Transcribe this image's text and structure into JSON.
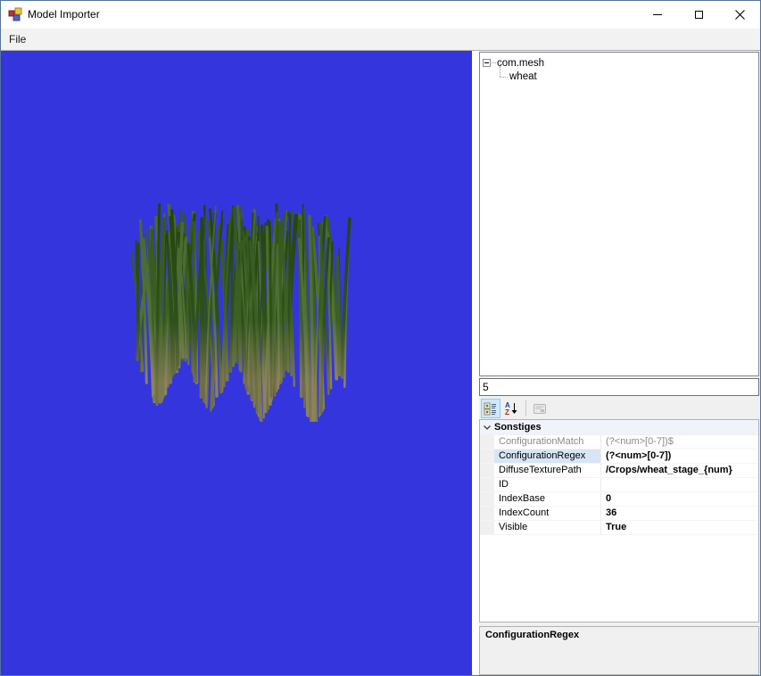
{
  "window": {
    "title": "Model Importer"
  },
  "titlebar": {
    "buttons": [
      "minimize",
      "maximize",
      "close"
    ]
  },
  "menu": {
    "items": [
      {
        "label": "File"
      }
    ]
  },
  "viewport": {
    "background_color": "#3535de",
    "model_name": "wheat"
  },
  "tree": {
    "root": {
      "label": "com.mesh",
      "expanded": true
    },
    "child": {
      "label": "wheat"
    }
  },
  "filterBox": {
    "value": "5"
  },
  "propertyGrid": {
    "toolbar": {
      "buttons": [
        "categorized",
        "alphabetical",
        "property-pages"
      ],
      "selected": "categorized"
    },
    "categoryLabel": "Sonstiges",
    "selectedProperty": "ConfigurationRegex",
    "rows": [
      {
        "name": "ConfigurationMatch",
        "value": "(?<num>[0-7])$",
        "state": "readonly",
        "modified": false
      },
      {
        "name": "ConfigurationRegex",
        "value": "(?<num>[0-7])",
        "state": "selected",
        "modified": true
      },
      {
        "name": "DiffuseTexturePath",
        "value": "/Crops/wheat_stage_{num}",
        "state": "normal",
        "modified": true
      },
      {
        "name": "ID",
        "value": "",
        "state": "normal",
        "modified": false
      },
      {
        "name": "IndexBase",
        "value": "0",
        "state": "normal",
        "modified": true
      },
      {
        "name": "IndexCount",
        "value": "36",
        "state": "normal",
        "modified": true
      },
      {
        "name": "Visible",
        "value": "True",
        "state": "normal",
        "modified": true
      }
    ],
    "help": {
      "title": "ConfigurationRegex"
    }
  },
  "colors": {
    "window_border": "#54749c",
    "viewport_blue": "#3535de",
    "panel_gray": "#f0f0f0",
    "selection_blue": "#d6e6f7",
    "toolbar_selected_bg": "#cde8ff"
  }
}
